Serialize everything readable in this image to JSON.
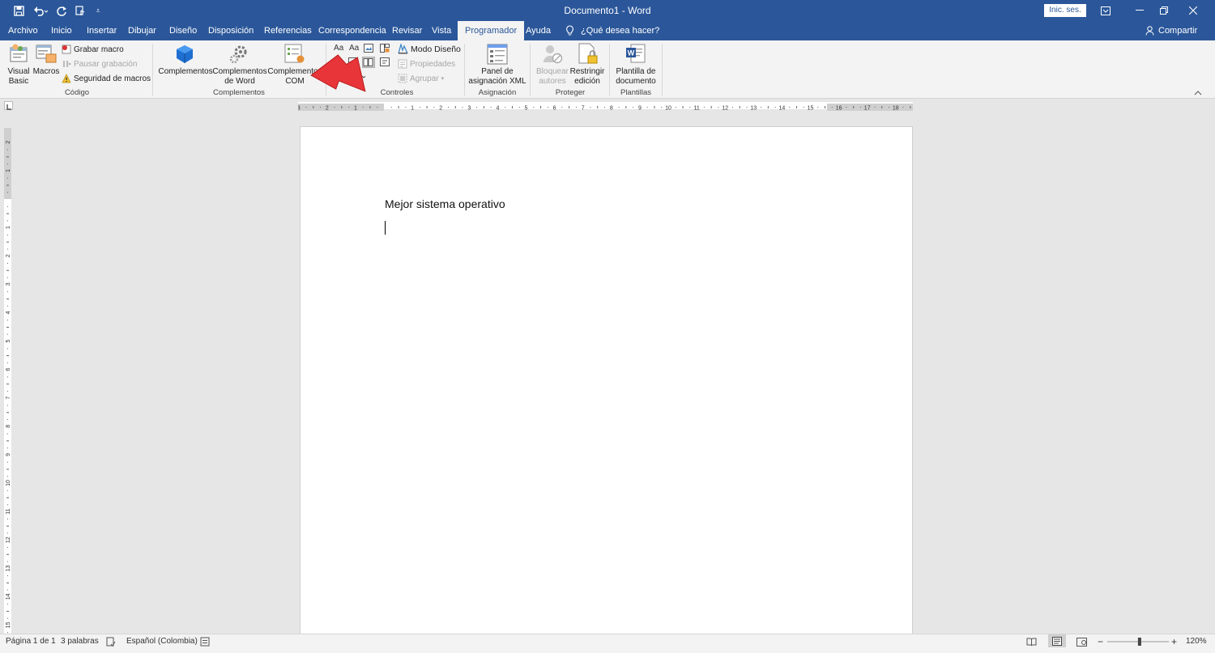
{
  "app": {
    "document_title": "Documento1 - Word",
    "signin_label": "Inic. ses."
  },
  "tabs": [
    "Archivo",
    "Inicio",
    "Insertar",
    "Dibujar",
    "Diseño",
    "Disposición",
    "Referencias",
    "Correspondencia",
    "Revisar",
    "Vista",
    "Programador",
    "Ayuda"
  ],
  "active_tab": "Programador",
  "tell_me": "¿Qué desea hacer?",
  "share_label": "Compartir",
  "ribbon": {
    "codigo": {
      "label": "Código",
      "visual_basic": "Visual Basic",
      "visual_basic_l1": "Visual",
      "visual_basic_l2": "Basic",
      "macros": "Macros",
      "grabar_macro": "Grabar macro",
      "pausar_grabacion": "Pausar grabación",
      "seguridad_macros": "Seguridad de macros"
    },
    "complementos": {
      "label": "Complementos",
      "complementos": "Complementos",
      "word_l1": "Complementos",
      "word_l2": "de Word",
      "com_l1": "Complementos",
      "com_l2": "COM"
    },
    "controles": {
      "label": "Controles",
      "modo_diseno": "Modo Diseño",
      "propiedades": "Propiedades",
      "agrupar": "Agrupar"
    },
    "asignacion": {
      "label": "Asignación",
      "panel_l1": "Panel de",
      "panel_l2": "asignación XML"
    },
    "proteger": {
      "label": "Proteger",
      "bloquear_l1": "Bloquear",
      "bloquear_l2": "autores",
      "restringir_l1": "Restringir",
      "restringir_l2": "edición"
    },
    "plantillas": {
      "label": "Plantillas",
      "plantilla_l1": "Plantilla de",
      "plantilla_l2": "documento"
    }
  },
  "document": {
    "text": "Mejor sistema operativo"
  },
  "status": {
    "page": "Página 1 de 1",
    "words": "3 palabras",
    "language": "Español (Colombia)",
    "zoom": "120%"
  },
  "colors": {
    "brand": "#2b579a",
    "ribbon_bg": "#f3f3f3",
    "arrow": "#e8353a"
  }
}
